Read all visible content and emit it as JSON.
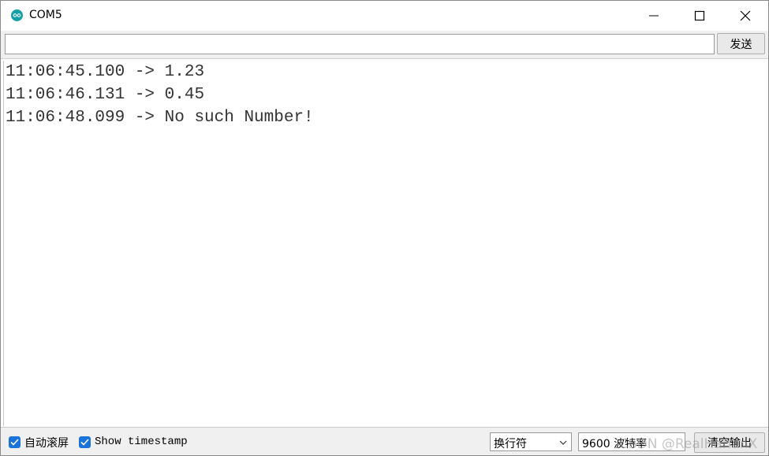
{
  "window": {
    "title": "COM5",
    "icon": "arduino-icon",
    "controls": [
      "minimize-icon",
      "maximize-icon",
      "close-icon"
    ]
  },
  "input_row": {
    "value": "",
    "send_label": "发送"
  },
  "output": {
    "lines": [
      "11:06:45.100 -> 1.23",
      "11:06:46.131 -> 0.45",
      "11:06:48.099 -> No such Number!"
    ]
  },
  "statusbar": {
    "autoscroll_label": "自动滚屏",
    "autoscroll_checked": true,
    "timestamp_label": "Show timestamp",
    "timestamp_checked": true,
    "line_ending": "换行符",
    "baud_rate": "9600 波特率",
    "clear_label": "清空输出",
    "watermark": "CSDN @RealHarlanX"
  },
  "colors": {
    "accent": "#1a73d9",
    "icon": "#15a0a8",
    "text": "#333333"
  }
}
